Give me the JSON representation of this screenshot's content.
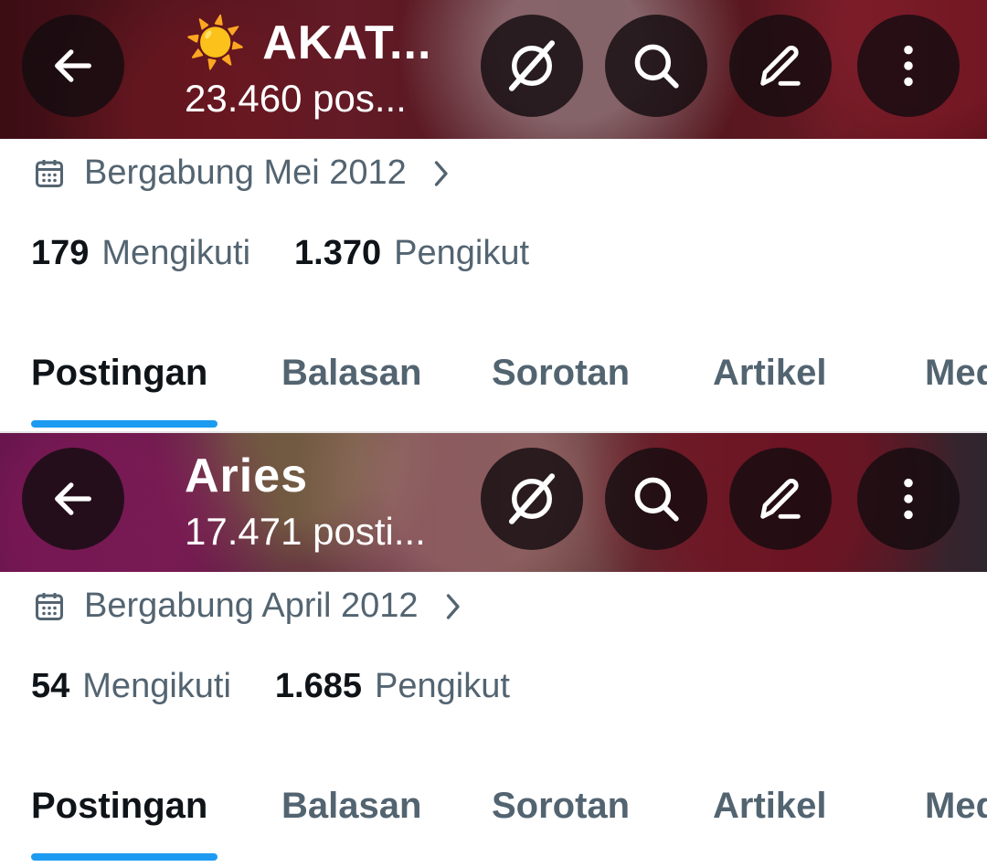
{
  "accent_color": "#1d9bf0",
  "profiles": [
    {
      "title_emoji": "☀️",
      "title": "AKAT...",
      "posts": "23.460 pos...",
      "joined": "Bergabung Mei 2012",
      "following_count": "179",
      "following_label": "Mengikuti",
      "followers_count": "1.370",
      "followers_label": "Pengikut",
      "tabs": [
        "Postingan",
        "Balasan",
        "Sorotan",
        "Artikel",
        "Med"
      ],
      "active_tab": "Postingan"
    },
    {
      "title_emoji": "",
      "title": "Aries",
      "posts": "17.471 posti...",
      "joined": "Bergabung April 2012",
      "following_count": "54",
      "following_label": "Mengikuti",
      "followers_count": "1.685",
      "followers_label": "Pengikut",
      "tabs": [
        "Postingan",
        "Balasan",
        "Sorotan",
        "Artikel",
        "Med"
      ],
      "active_tab": "Postingan"
    }
  ],
  "icons": {
    "back": "arrow-left-icon",
    "grok": "grok-icon",
    "search": "search-icon",
    "edit": "pencil-icon",
    "more": "more-vertical-icon",
    "calendar": "calendar-icon",
    "chevron": "chevron-right-icon"
  }
}
